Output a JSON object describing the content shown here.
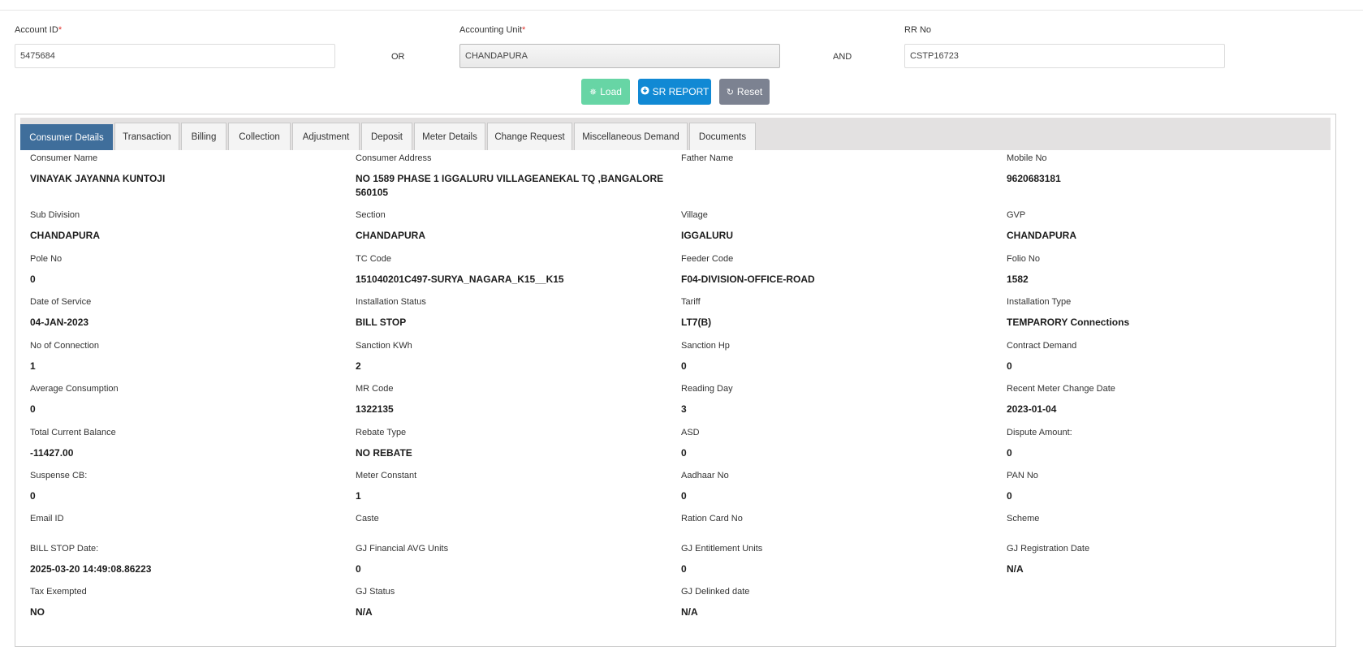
{
  "search": {
    "account_id_label": "Account ID",
    "account_id_value": "5475684",
    "or_label": "OR",
    "accounting_unit_label": "Accounting Unit",
    "accounting_unit_value": "CHANDAPURA",
    "and_label": "AND",
    "rr_no_label": "RR No",
    "rr_no_value": "CSTP16723",
    "required_mark": "*"
  },
  "actions": {
    "load": {
      "label": "Load",
      "icon": "spinner-icon"
    },
    "sr_report": {
      "label": "SR REPORT",
      "icon": "download-circle-icon"
    },
    "reset": {
      "label": "Reset",
      "icon": "refresh-icon"
    }
  },
  "colors": {
    "load_button": "#57d19c",
    "sr_report_button": "#1189d4",
    "reset_button": "#7c8291",
    "active_tab": "#3f6e9b",
    "required_asterisk": "#e3342f"
  },
  "tabs": [
    {
      "label": "Consumer Details",
      "active": true
    },
    {
      "label": "Transaction",
      "active": false
    },
    {
      "label": "Billing",
      "active": false
    },
    {
      "label": "Collection",
      "active": false
    },
    {
      "label": "Adjustment",
      "active": false
    },
    {
      "label": "Deposit",
      "active": false
    },
    {
      "label": "Meter Details",
      "active": false
    },
    {
      "label": "Change Request",
      "active": false
    },
    {
      "label": "Miscellaneous Demand",
      "active": false
    },
    {
      "label": "Documents",
      "active": false
    }
  ],
  "details": [
    [
      {
        "label": "Consumer Name",
        "value": "VINAYAK JAYANNA KUNTOJI"
      },
      {
        "label": "Consumer Address",
        "value": "NO 1589 PHASE 1 IGGALURU VILLAGEANEKAL TQ ,BANGALORE 560105"
      },
      {
        "label": "Father Name",
        "value": ""
      },
      {
        "label": "Mobile No",
        "value": "9620683181"
      }
    ],
    [
      {
        "label": "Sub Division",
        "value": "CHANDAPURA"
      },
      {
        "label": "Section",
        "value": "CHANDAPURA"
      },
      {
        "label": "Village",
        "value": "IGGALURU"
      },
      {
        "label": "GVP",
        "value": "CHANDAPURA"
      }
    ],
    [
      {
        "label": "Pole No",
        "value": "0"
      },
      {
        "label": "TC Code",
        "value": "151040201C497-SURYA_NAGARA_K15__K15"
      },
      {
        "label": "Feeder Code",
        "value": "F04-DIVISION-OFFICE-ROAD"
      },
      {
        "label": "Folio No",
        "value": "1582"
      }
    ],
    [
      {
        "label": "Date of Service",
        "value": "04-JAN-2023"
      },
      {
        "label": "Installation Status",
        "value": "BILL STOP"
      },
      {
        "label": "Tariff",
        "value": "LT7(B)"
      },
      {
        "label": "Installation Type",
        "value": "TEMPARORY Connections"
      }
    ],
    [
      {
        "label": "No of Connection",
        "value": "1"
      },
      {
        "label": "Sanction KWh",
        "value": "2"
      },
      {
        "label": "Sanction Hp",
        "value": "0"
      },
      {
        "label": "Contract Demand",
        "value": "0"
      }
    ],
    [
      {
        "label": "Average Consumption",
        "value": "0"
      },
      {
        "label": "MR Code",
        "value": "1322135"
      },
      {
        "label": "Reading Day",
        "value": "3"
      },
      {
        "label": "Recent Meter Change Date",
        "value": "2023-01-04"
      }
    ],
    [
      {
        "label": "Total Current Balance",
        "value": "-11427.00"
      },
      {
        "label": "Rebate Type",
        "value": "NO REBATE"
      },
      {
        "label": "ASD",
        "value": "0"
      },
      {
        "label": "Dispute Amount:",
        "value": "0"
      }
    ],
    [
      {
        "label": "Suspense CB:",
        "value": "0"
      },
      {
        "label": "Meter Constant",
        "value": "1"
      },
      {
        "label": "Aadhaar No",
        "value": "0"
      },
      {
        "label": "PAN No",
        "value": "0"
      }
    ],
    [
      {
        "label": "Email ID",
        "value": ""
      },
      {
        "label": "Caste",
        "value": ""
      },
      {
        "label": "Ration Card No",
        "value": ""
      },
      {
        "label": "Scheme",
        "value": ""
      }
    ],
    [
      {
        "label": "BILL STOP Date:",
        "value": "2025-03-20 14:49:08.86223"
      },
      {
        "label": "GJ Financial AVG Units",
        "value": "0"
      },
      {
        "label": "GJ Entitlement Units",
        "value": "0"
      },
      {
        "label": "GJ Registration Date",
        "value": "N/A"
      }
    ],
    [
      {
        "label": "Tax Exempted",
        "value": "NO"
      },
      {
        "label": "GJ Status",
        "value": "N/A"
      },
      {
        "label": "GJ Delinked date",
        "value": "N/A"
      }
    ]
  ]
}
